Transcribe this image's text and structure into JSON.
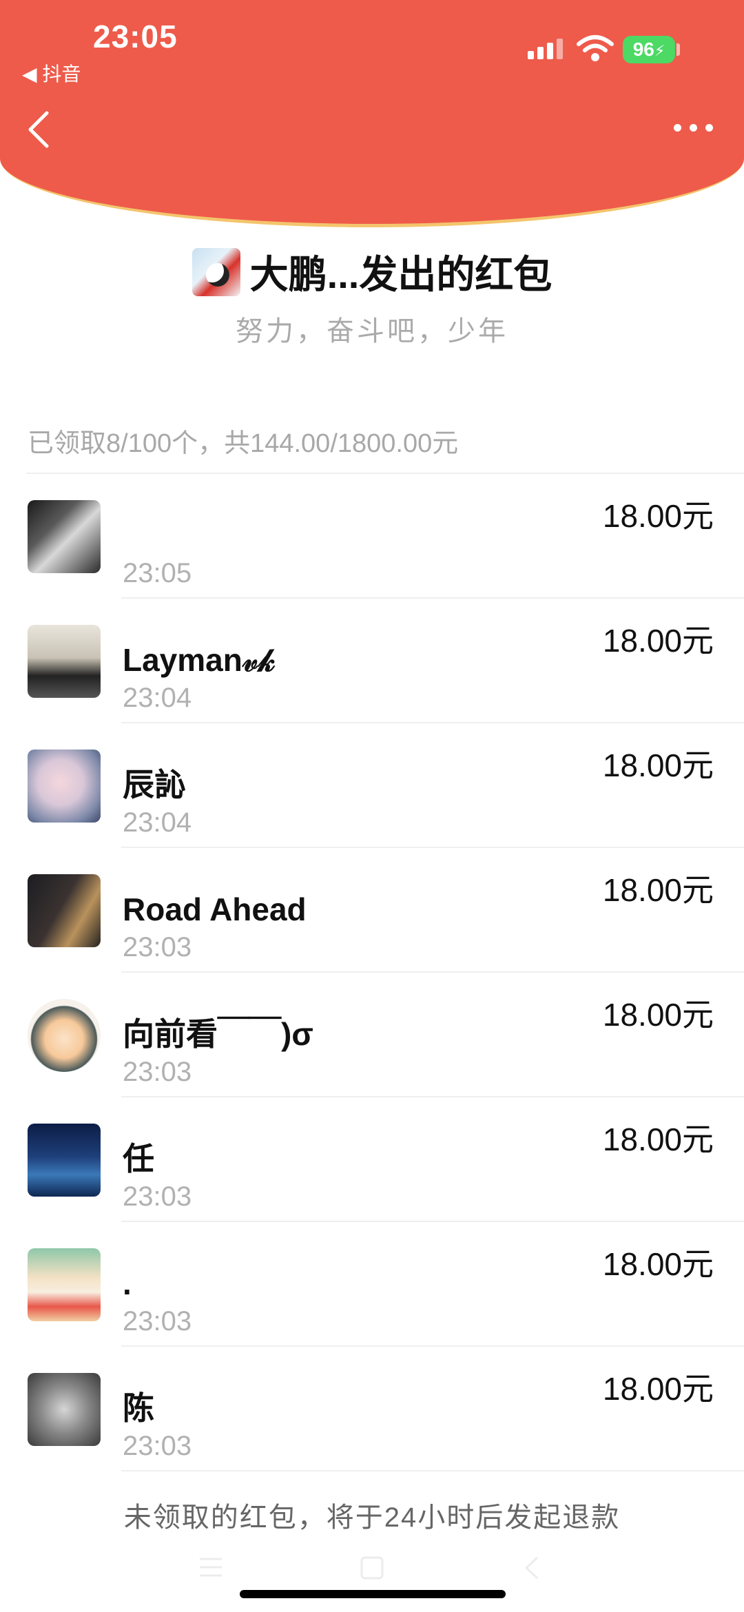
{
  "status_bar": {
    "time": "23:05",
    "back_app_label": "◀ 抖音",
    "battery": "96"
  },
  "header": {
    "sender_title": "大鹏...发出的红包",
    "blessing": "努力，奋斗吧，少年",
    "summary": "已领取8/100个，共144.00/1800.00元"
  },
  "receivers": [
    {
      "name": "",
      "time": "23:05",
      "amount": "18.00元"
    },
    {
      "name": "Layman𝓋𝓀",
      "time": "23:04",
      "amount": "18.00元"
    },
    {
      "name": "辰訫",
      "time": "23:04",
      "amount": "18.00元"
    },
    {
      "name": "Road Ahead",
      "time": "23:03",
      "amount": "18.00元"
    },
    {
      "name": "向前看￣￣)σ",
      "time": "23:03",
      "amount": "18.00元"
    },
    {
      "name": "任",
      "time": "23:03",
      "amount": "18.00元"
    },
    {
      "name": ".",
      "time": "23:03",
      "amount": "18.00元"
    },
    {
      "name": "陈",
      "time": "23:03",
      "amount": "18.00元"
    }
  ],
  "footer_note": "未领取的红包，将于24小时后发起退款",
  "colors": {
    "header_red": "#ee5b4b",
    "header_border_gold": "#f4c56d",
    "muted_text": "#a8a8a8"
  }
}
